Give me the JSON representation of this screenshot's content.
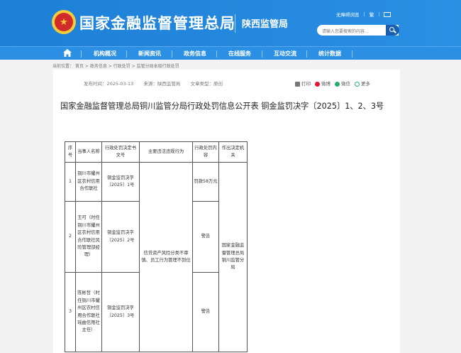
{
  "header": {
    "site_title": "国家金融监督管理总局",
    "sub_title": "陕西监管局",
    "top_links": [
      "无障碍浏览",
      "繁"
    ],
    "search_placeholder": "请输入您要搜索的内容..."
  },
  "nav": {
    "items": [
      "机构概况",
      "新闻资讯",
      "政务信息",
      "在线服务",
      "互动交流",
      "统计数据"
    ]
  },
  "breadcrumb": {
    "label": "当前位置：",
    "items": [
      "首页",
      "政务信息",
      "行政处罚",
      "监管分局本级行政处罚"
    ],
    "separator": ">"
  },
  "meta": {
    "publish_time": "发布时间：2025-03-13",
    "source": "来源：陕西监管局",
    "doc_type": "文章类型：原创"
  },
  "share": {
    "print": "打印",
    "weibo": "微博",
    "wechat": "微信",
    "more": "更多"
  },
  "article": {
    "title": "国家金融监督管理总局铜川监管分局行政处罚信息公开表 铜金监罚决字〔2025〕1、2、3号"
  },
  "table": {
    "headers": [
      "序号",
      "当事人名称",
      "行政处罚决定书文号",
      "主要违法违规行为",
      "行政处罚内容",
      "作出决定机关"
    ],
    "rows": [
      {
        "no": "1",
        "party": "铜川市耀州区农村信用合作联社",
        "doc_no": "铜金监罚决字〔2025〕1号",
        "penalty": "罚款58万元"
      },
      {
        "no": "2",
        "party": "王可（时任铜川市耀州区农村信用合作联社风险管理部经理）",
        "doc_no": "铜金监罚决字〔2025〕2号",
        "penalty": "警告"
      },
      {
        "no": "3",
        "party": "陈彬哲（时任铜川市耀州区农村信用合作联社瑶曲信用社主任）",
        "doc_no": "铜金监罚决字〔2025〕3号",
        "penalty": "警告"
      }
    ],
    "violation": "信贷资产风险分类不审慎、员工行为管理不到位",
    "authority": "国家金融监督管理总局铜川监管分局"
  },
  "colors": {
    "header_blue": "#1d7fd6",
    "nav_blue": "#2b8fe3",
    "search_button": "#1a5fae",
    "page_bg": "#f2f2f2"
  }
}
